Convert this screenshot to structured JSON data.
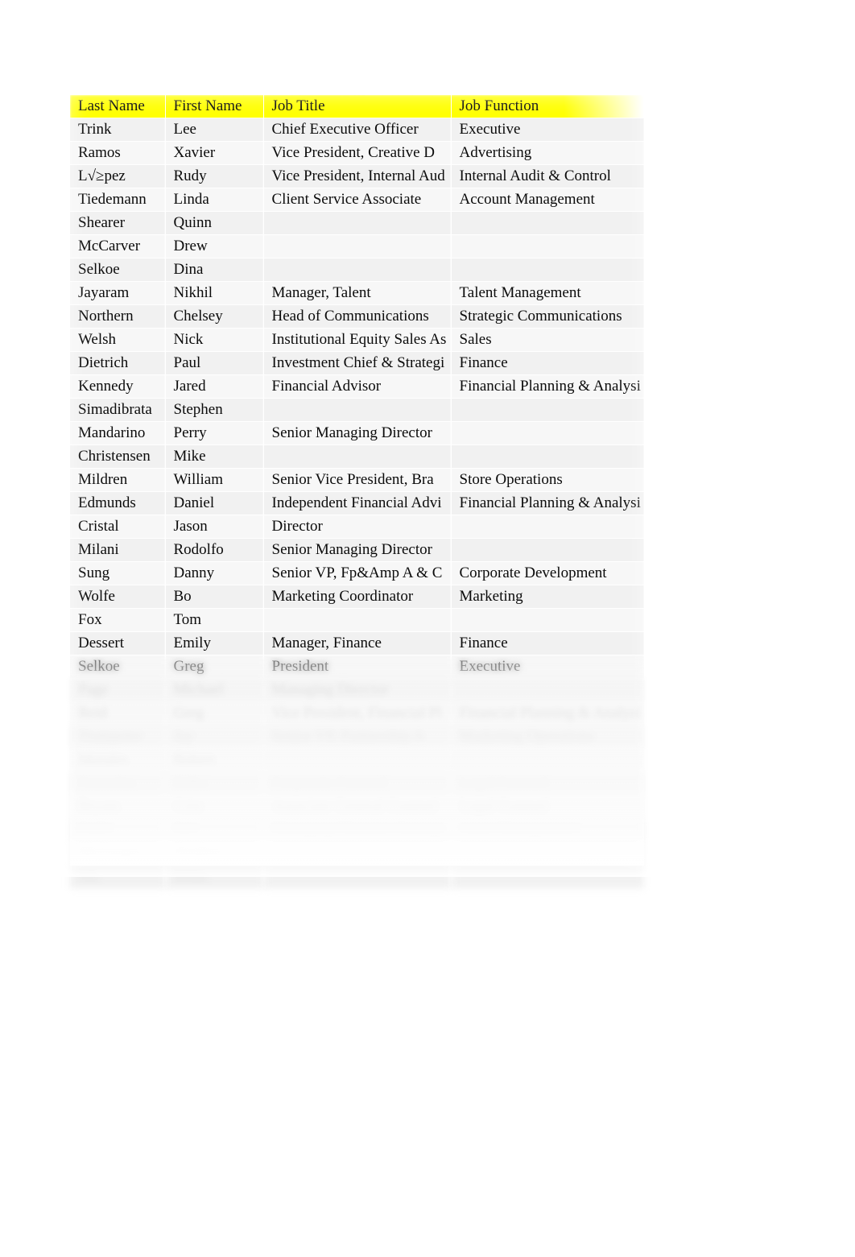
{
  "document": {
    "type": "spreadsheet-contact-list",
    "header_highlight_color": "#ffff00",
    "row_band_colors": [
      "#f1f1f1",
      "#f7f7f7"
    ],
    "text_color": "#0b0b0b"
  },
  "table": {
    "columns": [
      {
        "key": "last_name",
        "label": "Last Name"
      },
      {
        "key": "first_name",
        "label": "First Name"
      },
      {
        "key": "job_title",
        "label": "Job Title"
      },
      {
        "key": "job_function",
        "label": "Job Function"
      }
    ],
    "rows": [
      {
        "last_name": "Trink",
        "first_name": "Lee",
        "job_title": "Chief Executive Officer",
        "job_function": "Executive"
      },
      {
        "last_name": "Ramos",
        "first_name": "Xavier",
        "job_title": "Vice President, Creative D",
        "job_function": "Advertising"
      },
      {
        "last_name": "L√≥pez",
        "first_name": "Rudy",
        "job_title": "Vice President, Internal Aud",
        "job_function": "Internal Audit & Control"
      },
      {
        "last_name": "Tiedemann",
        "first_name": "Linda",
        "job_title": "Client Service Associate",
        "job_function": "Account Management"
      },
      {
        "last_name": "Shearer",
        "first_name": "Quinn",
        "job_title": "",
        "job_function": ""
      },
      {
        "last_name": "McCarver",
        "first_name": "Drew",
        "job_title": "",
        "job_function": ""
      },
      {
        "last_name": "Selkoe",
        "first_name": "Dina",
        "job_title": "",
        "job_function": ""
      },
      {
        "last_name": "Jayaram",
        "first_name": "Nikhil",
        "job_title": "Manager, Talent",
        "job_function": "Talent Management"
      },
      {
        "last_name": "Northern",
        "first_name": "Chelsey",
        "job_title": "Head of Communications",
        "job_function": "Strategic Communications"
      },
      {
        "last_name": "Welsh",
        "first_name": "Nick",
        "job_title": "Institutional Equity Sales As",
        "job_function": "Sales"
      },
      {
        "last_name": "Dietrich",
        "first_name": "Paul",
        "job_title": "Investment Chief & Strategi",
        "job_function": "Finance"
      },
      {
        "last_name": "Kennedy",
        "first_name": "Jared",
        "job_title": "Financial Advisor",
        "job_function": "Financial Planning & Analysi"
      },
      {
        "last_name": "Simadibrata",
        "first_name": "Stephen",
        "job_title": "",
        "job_function": ""
      },
      {
        "last_name": "Mandarino",
        "first_name": "Perry",
        "job_title": "Senior Managing Director",
        "job_function": ""
      },
      {
        "last_name": "Christensen",
        "first_name": "Mike",
        "job_title": "",
        "job_function": ""
      },
      {
        "last_name": "Mildren",
        "first_name": "William",
        "job_title": "Senior Vice President, Bra",
        "job_function": "Store Operations"
      },
      {
        "last_name": "Edmunds",
        "first_name": "Daniel",
        "job_title": "Independent Financial Advi",
        "job_function": "Financial Planning & Analysi"
      },
      {
        "last_name": "Cristal",
        "first_name": "Jason",
        "job_title": "Director",
        "job_function": ""
      },
      {
        "last_name": "Milani",
        "first_name": "Rodolfo",
        "job_title": "Senior Managing Director",
        "job_function": ""
      },
      {
        "last_name": "Sung",
        "first_name": "Danny",
        "job_title": "Senior VP, Fp&Amp A & C",
        "job_function": "Corporate Development"
      },
      {
        "last_name": "Wolfe",
        "first_name": "Bo",
        "job_title": "Marketing Coordinator",
        "job_function": "Marketing"
      },
      {
        "last_name": "Fox",
        "first_name": "Tom",
        "job_title": "",
        "job_function": ""
      },
      {
        "last_name": "Dessert",
        "first_name": "Emily",
        "job_title": "Manager, Finance",
        "job_function": "Finance"
      },
      {
        "last_name": "Selkoe",
        "first_name": "Greg",
        "job_title": "President",
        "job_function": "Executive"
      },
      {
        "last_name": "Page",
        "first_name": "Michael",
        "job_title": "Managing Director",
        "job_function": ""
      },
      {
        "last_name": "Reid",
        "first_name": "Greg",
        "job_title": "Vice President, Financial Pl",
        "job_function": "Financial Planning & Analysi"
      },
      {
        "last_name": "Trumpeter",
        "first_name": "Jay",
        "job_title": "Senior VP, Partnership A",
        "job_function": "Marketing Operations"
      },
      {
        "last_name": "Morales",
        "first_name": "Robert",
        "job_title": "",
        "job_function": ""
      },
      {
        "last_name": "Gonzalez",
        "first_name": "Erika",
        "job_title": "Corporate Counsel",
        "job_function": "Legal Counsel"
      },
      {
        "last_name": "Bryant",
        "first_name": "Crist",
        "job_title": "Associate General Counsel",
        "job_function": "Legal Counsel"
      },
      {
        "last_name": "Cady",
        "first_name": "Jon",
        "job_title": "Managing Director, Strategi",
        "job_function": "Asset Management"
      },
      {
        "last_name": "McGregor",
        "first_name": "Stephen",
        "job_title": "",
        "job_function": ""
      },
      {
        "last_name": "Ma",
        "first_name": "Brian",
        "job_title": "",
        "job_function": ""
      }
    ]
  }
}
